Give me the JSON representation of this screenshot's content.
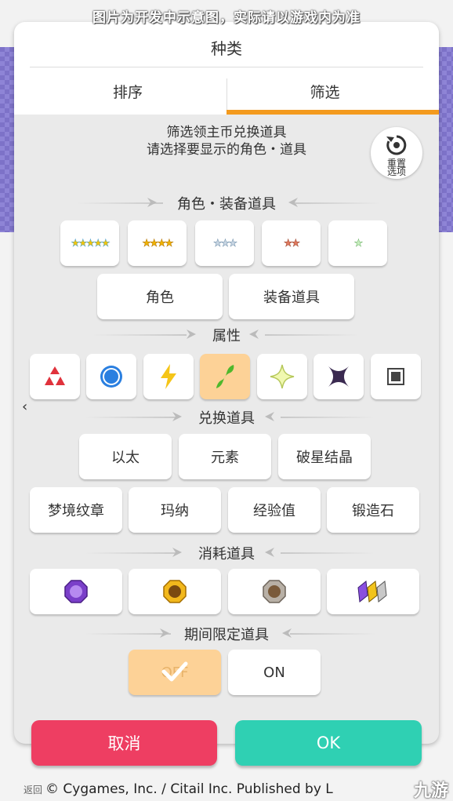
{
  "watermark": "图片为开发中示意图，实际请以游戏内为准",
  "dialog": {
    "title": "种类",
    "tabs": [
      {
        "label": "排序",
        "active": false
      },
      {
        "label": "筛选",
        "active": true
      }
    ],
    "accent": "#f39a1e"
  },
  "filter": {
    "description_line1": "筛选领主币兑换道具",
    "description_line2": "请选择要显示的角色・道具",
    "reset_label_1": "重置",
    "reset_label_2": "选项",
    "sections": {
      "characters": {
        "title": "角色・装备道具",
        "rarities": [
          "★★★★★",
          "★★★★",
          "★★★",
          "★★",
          "★"
        ],
        "types": [
          "角色",
          "装备道具"
        ]
      },
      "attributes": {
        "title": "属性",
        "items": [
          "fire-icon",
          "water-icon",
          "thunder-icon",
          "wind-icon",
          "light-icon",
          "dark-icon",
          "none-icon"
        ],
        "selected": "wind-icon"
      },
      "exchange": {
        "title": "兑换道具",
        "row1": [
          "以太",
          "元素",
          "破星结晶"
        ],
        "row2": [
          "梦境纹章",
          "玛纳",
          "经验值",
          "锻造石"
        ]
      },
      "consumables": {
        "title": "消耗道具",
        "items": [
          "purple-medal-icon",
          "gold-medal-icon",
          "bronze-medal-icon",
          "ticket-stack-icon"
        ]
      },
      "limited": {
        "title": "期间限定道具",
        "off_label": "OFF",
        "on_label": "ON",
        "selected": "OFF"
      }
    }
  },
  "actions": {
    "cancel": "取消",
    "ok": "OK",
    "cancel_color": "#ee3e62",
    "ok_color": "#2fd0b3"
  },
  "footer": {
    "back": "返回",
    "copyright": "© Cygames, Inc. / Citail Inc. Published by L",
    "logo": "九游"
  }
}
